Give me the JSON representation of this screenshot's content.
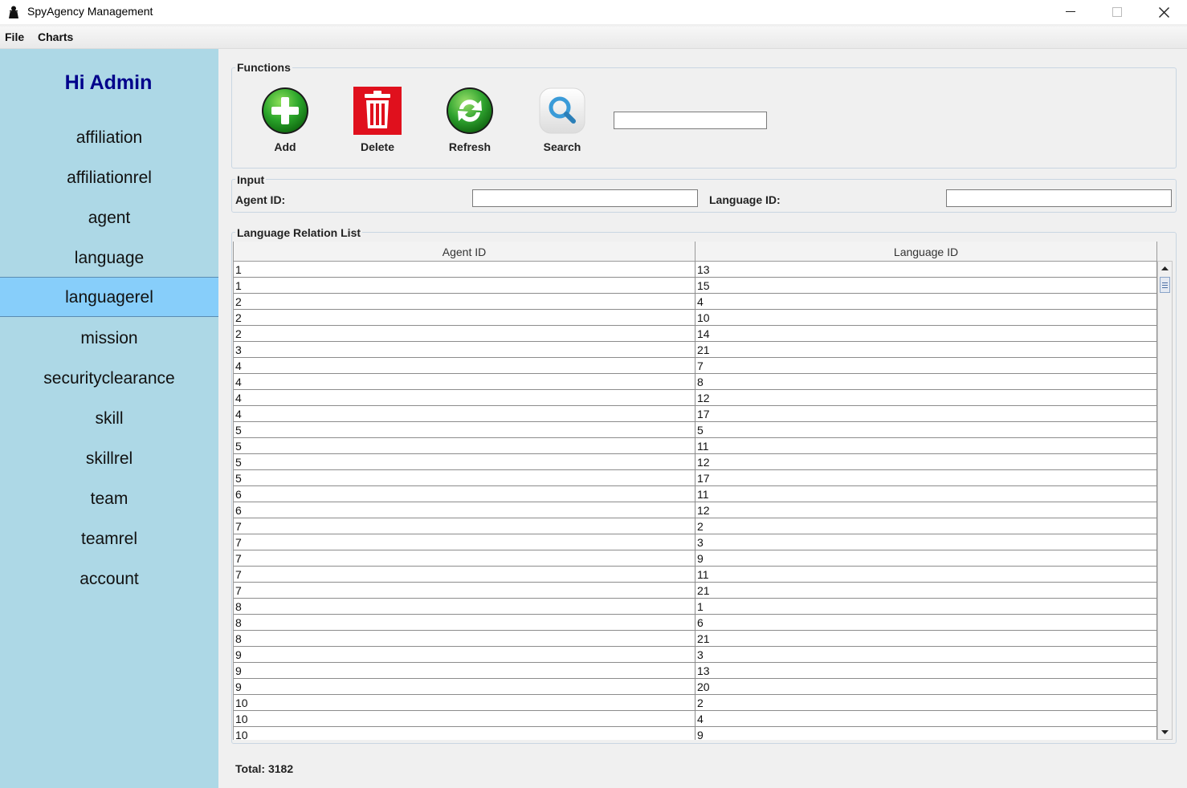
{
  "window": {
    "title": "SpyAgency Management"
  },
  "menu": {
    "items": [
      "File",
      "Charts"
    ]
  },
  "sidebar": {
    "greeting": "Hi Admin",
    "items": [
      "affiliation",
      "affiliationrel",
      "agent",
      "language",
      "languagerel",
      "mission",
      "securityclearance",
      "skill",
      "skillrel",
      "team",
      "teamrel",
      "account"
    ],
    "active": "languagerel"
  },
  "functions": {
    "title": "Functions",
    "add_label": "Add",
    "delete_label": "Delete",
    "refresh_label": "Refresh",
    "search_label": "Search",
    "search_value": ""
  },
  "input": {
    "title": "Input",
    "agent_id_label": "Agent ID:",
    "agent_id_value": "",
    "language_id_label": "Language ID:",
    "language_id_value": ""
  },
  "table": {
    "title": "Language Relation List",
    "columns": [
      "Agent ID",
      "Language ID"
    ],
    "rows": [
      [
        "1",
        "13"
      ],
      [
        "1",
        "15"
      ],
      [
        "2",
        "4"
      ],
      [
        "2",
        "10"
      ],
      [
        "2",
        "14"
      ],
      [
        "3",
        "21"
      ],
      [
        "4",
        "7"
      ],
      [
        "4",
        "8"
      ],
      [
        "4",
        "12"
      ],
      [
        "4",
        "17"
      ],
      [
        "5",
        "5"
      ],
      [
        "5",
        "11"
      ],
      [
        "5",
        "12"
      ],
      [
        "5",
        "17"
      ],
      [
        "6",
        "11"
      ],
      [
        "6",
        "12"
      ],
      [
        "7",
        "2"
      ],
      [
        "7",
        "3"
      ],
      [
        "7",
        "9"
      ],
      [
        "7",
        "11"
      ],
      [
        "7",
        "21"
      ],
      [
        "8",
        "1"
      ],
      [
        "8",
        "6"
      ],
      [
        "8",
        "21"
      ],
      [
        "9",
        "3"
      ],
      [
        "9",
        "13"
      ],
      [
        "9",
        "20"
      ],
      [
        "10",
        "2"
      ],
      [
        "10",
        "4"
      ],
      [
        "10",
        "9"
      ]
    ]
  },
  "footer": {
    "total": "Total: 3182"
  },
  "colors": {
    "sidebar_bg": "#add8e6",
    "sidebar_active": "#87cefa",
    "greeting": "#00008b",
    "add_green": "#2aa52a",
    "delete_red": "#e0101d",
    "search_blue": "#3a9bd8"
  }
}
